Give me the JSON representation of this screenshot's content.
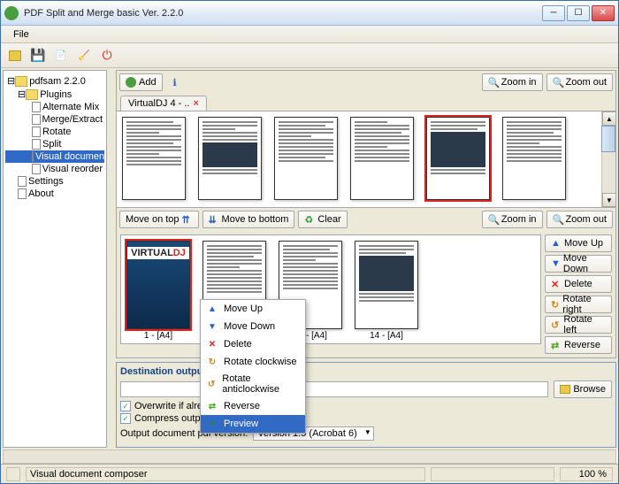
{
  "window": {
    "title": "PDF Split and Merge basic Ver. 2.2.0"
  },
  "menubar": {
    "file": "File"
  },
  "tree": {
    "root": "pdfsam 2.2.0",
    "plugins": "Plugins",
    "items": [
      "Alternate Mix",
      "Merge/Extract",
      "Rotate",
      "Split",
      "Visual document",
      "Visual reorder"
    ],
    "settings": "Settings",
    "about": "About"
  },
  "top_toolbar": {
    "add": "Add",
    "zoom_in": "Zoom in",
    "zoom_out": "Zoom out"
  },
  "tab": {
    "label": "VirtualDJ 4 - .."
  },
  "mid_toolbar": {
    "move_top": "Move on top",
    "move_bottom": "Move to bottom",
    "clear": "Clear",
    "zoom_in": "Zoom in",
    "zoom_out": "Zoom out"
  },
  "func": {
    "move_up": "Move Up",
    "move_down": "Move Down",
    "delete": "Delete",
    "rotate_right": "Rotate right",
    "rotate_left": "Rotate left",
    "reverse": "Reverse"
  },
  "bottom_thumbs": {
    "l1": "1 - [A4]",
    "l3": "22 - [A4]",
    "l4": "14 - [A4]",
    "virtualdj_pre": "VIRTUAL",
    "virtualdj_dj": "DJ"
  },
  "context": {
    "move_up": "Move Up",
    "move_down": "Move Down",
    "delete": "Delete",
    "rotate_cw": "Rotate clockwise",
    "rotate_acw": "Rotate anticlockwise",
    "reverse": "Reverse",
    "preview": "Preview"
  },
  "dest": {
    "title": "Destination output fil",
    "browse": "Browse",
    "overwrite": "Overwrite if already exists",
    "compress": "Compress output file/files",
    "version_label": "Output document pdf version:",
    "version_value": "Version 1.5 (Acrobat 6)"
  },
  "status": {
    "text": "Visual document composer",
    "pct": "100 %"
  }
}
